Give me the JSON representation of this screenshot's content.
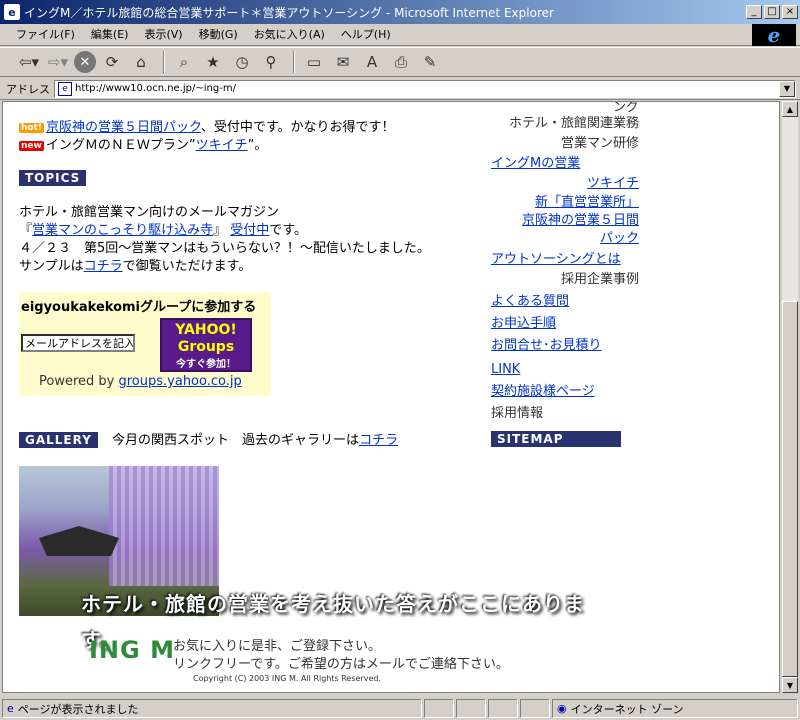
{
  "window": {
    "title": "イングM／ホテル旅館の総合営業サポート＊営業アウトソーシング - Microsoft Internet Explorer",
    "controls": [
      "_",
      "□",
      "×"
    ]
  },
  "menu": [
    "ファイル(F)",
    "編集(E)",
    "表示(V)",
    "移動(G)",
    "お気に入り(A)",
    "ヘルプ(H)"
  ],
  "toolbar": {
    "icons": [
      "back-icon",
      "forward-icon",
      "stop-icon",
      "refresh-icon",
      "home-icon",
      "search-icon",
      "favorites-icon",
      "history-icon",
      "channels-icon",
      "fullscreen-icon",
      "mail-icon",
      "font-icon",
      "print-icon",
      "edit-icon"
    ]
  },
  "address": {
    "label": "アドレス",
    "url": "http://www10.ocn.ne.jp/~ing-m/"
  },
  "content": {
    "news": [
      {
        "badge": "hot!",
        "link": "京阪神の営業５日間パック",
        "text": "、受付中です。かなりお得です！"
      },
      {
        "badge": "new",
        "prefix": "イングＭのＮＥＷプラン”",
        "link": "ツキイチ",
        "suffix": "”。"
      }
    ],
    "topics": {
      "header": "TOPICS",
      "line1": "ホテル・旅館営業マン向けのメールマガジン",
      "line2_prefix": "『",
      "line2_link": "営業マンのこっそり駆け込み寺",
      "line2_mid": "』 ",
      "line2_link2": "受付中",
      "line2_suffix": "です。",
      "line3": "４／２３　第5回～営業マンはもういらない？！～配信いたしました。",
      "line4_prefix": "サンプルは",
      "line4_link": "コチラ",
      "line4_suffix": "で御覧いただけます。"
    },
    "yahoo": {
      "title": "eigyoukakekomiグループに参加する",
      "placeholder": "メールアドレスを記入",
      "btn_top": "YAHOO!",
      "btn_mid": "Groups",
      "btn_sub": "今すぐ参加！",
      "powered": "Powered by",
      "powered_link": "groups.yahoo.co.jp"
    },
    "gallery": {
      "header": "GALLERY",
      "text": "今月の関西スポット　過去のギャラリーは",
      "link": "コチラ"
    },
    "banner": "ホテル・旅館の営業を考え抜いた答えがここにあります。",
    "footer": {
      "logo": "ING M",
      "line1": "お気に入りに是非、ご登録下さい。",
      "line2": "リンクフリーです。ご希望の方はメールでご連絡下さい。",
      "copyright": "Copyright (C) 2003 ING M. All Rights Reserved."
    }
  },
  "rightnav": {
    "partial": "ング",
    "item1": "ホテル・旅館関連業務",
    "item2": "営業マン研修",
    "link1": "イングMの営業",
    "link2": "ツキイチ",
    "link3": "新「直営営業所」",
    "link4a": "京阪神の営業５日間",
    "link4b": "パック",
    "link5": "アウトソーシングとは",
    "item3": "採用企業事例",
    "link6": "よくある質問",
    "link7": "お申込手順",
    "link8": "お問合せ･お見積り",
    "link9": "LINK",
    "link10": "契約施設様ページ",
    "item4": "採用情報",
    "sitemap": "SITEMAP"
  },
  "status": {
    "left": "ページが表示されました",
    "right": "インターネット ゾーン"
  }
}
